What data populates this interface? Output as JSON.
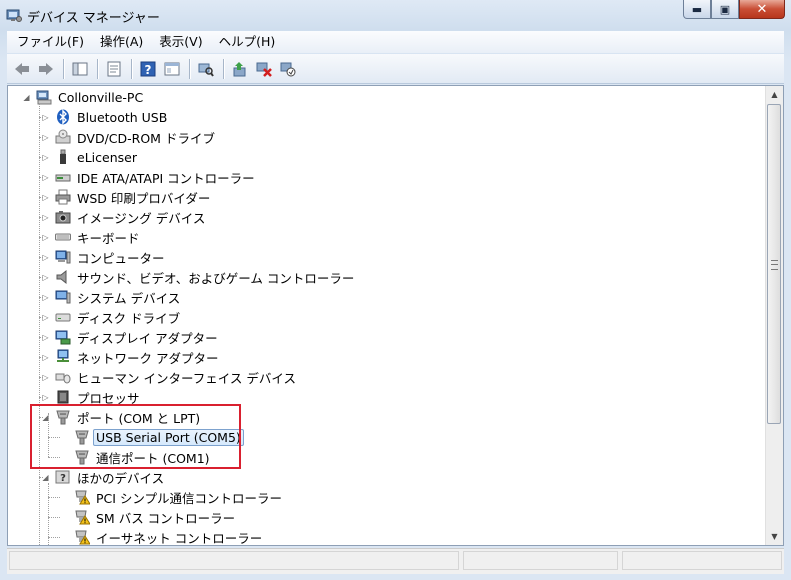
{
  "window": {
    "title": "デバイス マネージャー",
    "caption": {
      "minimize": "▬",
      "maximize": "▣",
      "close": "✕"
    }
  },
  "menu": [
    "ファイル(F)",
    "操作(A)",
    "表示(V)",
    "ヘルプ(H)"
  ],
  "toolbar": {
    "icons": [
      "back-icon",
      "forward-icon",
      "show-hide-console-tree-icon",
      "properties-icon",
      "help-icon",
      "console-view-icon",
      "scan-hardware-icon",
      "update-driver-icon",
      "uninstall-icon",
      "enable-device-icon"
    ]
  },
  "tree": {
    "root": "Collonville-PC",
    "categories": [
      {
        "label": "Bluetooth USB",
        "icon": "bluetooth-icon"
      },
      {
        "label": "DVD/CD-ROM ドライブ",
        "icon": "dvd-drive-icon"
      },
      {
        "label": "eLicenser",
        "icon": "usb-key-icon"
      },
      {
        "label": "IDE ATA/ATAPI コントローラー",
        "icon": "ide-controller-icon"
      },
      {
        "label": "WSD 印刷プロバイダー",
        "icon": "printer-icon"
      },
      {
        "label": "イメージング デバイス",
        "icon": "camera-icon"
      },
      {
        "label": "キーボード",
        "icon": "keyboard-icon"
      },
      {
        "label": "コンピューター",
        "icon": "computer-icon"
      },
      {
        "label": "サウンド、ビデオ、およびゲーム コントローラー",
        "icon": "speaker-icon"
      },
      {
        "label": "システム デバイス",
        "icon": "system-device-icon"
      },
      {
        "label": "ディスク ドライブ",
        "icon": "disk-drive-icon"
      },
      {
        "label": "ディスプレイ アダプター",
        "icon": "display-adapter-icon"
      },
      {
        "label": "ネットワーク アダプター",
        "icon": "network-adapter-icon"
      },
      {
        "label": "ヒューマン インターフェイス デバイス",
        "icon": "hid-icon"
      },
      {
        "label": "プロセッサ",
        "icon": "processor-icon"
      },
      {
        "label": "ポート (COM と LPT)",
        "icon": "port-icon"
      },
      {
        "label": "USB Serial Port (COM5)",
        "icon": "port-icon",
        "child": true,
        "selected": true
      },
      {
        "label": "通信ポート (COM1)",
        "icon": "port-icon",
        "child": true
      },
      {
        "label": "ほかのデバイス",
        "icon": "unknown-device-icon"
      },
      {
        "label": "PCI シンプル通信コントローラー",
        "icon": "warning-device-icon",
        "child": true
      },
      {
        "label": "SM バス コントローラー",
        "icon": "warning-device-icon",
        "child": true
      },
      {
        "label": "イーサネット コントローラー",
        "icon": "warning-device-icon",
        "child": true
      }
    ]
  },
  "colors": {
    "highlight_border": "#d9202f",
    "selection": "#d6e9fc"
  }
}
